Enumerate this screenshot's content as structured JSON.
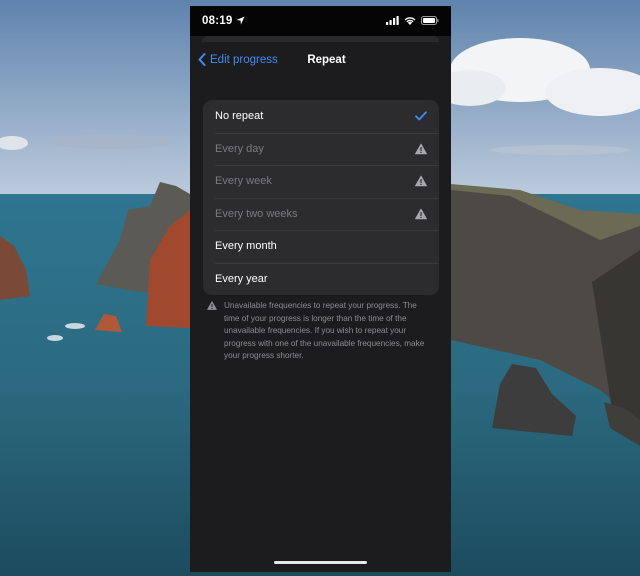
{
  "status_bar": {
    "time": "08:19",
    "icons": [
      "location-arrow-icon",
      "cellular-signal-icon",
      "wifi-icon",
      "battery-icon"
    ]
  },
  "nav": {
    "back_label": "Edit progress",
    "title": "Repeat"
  },
  "options": [
    {
      "label": "No repeat",
      "state": "selected",
      "icon": "checkmark-icon"
    },
    {
      "label": "Every day",
      "state": "unavailable",
      "icon": "warning-icon"
    },
    {
      "label": "Every week",
      "state": "unavailable",
      "icon": "warning-icon"
    },
    {
      "label": "Every two weeks",
      "state": "unavailable",
      "icon": "warning-icon"
    },
    {
      "label": "Every month",
      "state": "available",
      "icon": ""
    },
    {
      "label": "Every year",
      "state": "available",
      "icon": ""
    }
  ],
  "footer_note": "Unavailable frequencies to repeat your progress. The time of your progress is longer than the time of the unavailable frequencies. If you wish to repeat your progress with one of the unavailable frequencies, make your progress shorter.",
  "colors": {
    "accent": "#3d8cf4",
    "background": "#1c1c1e",
    "group": "#2c2c2e",
    "disabled_text": "#7b7b7f",
    "secondary_text": "#8d8d92"
  }
}
